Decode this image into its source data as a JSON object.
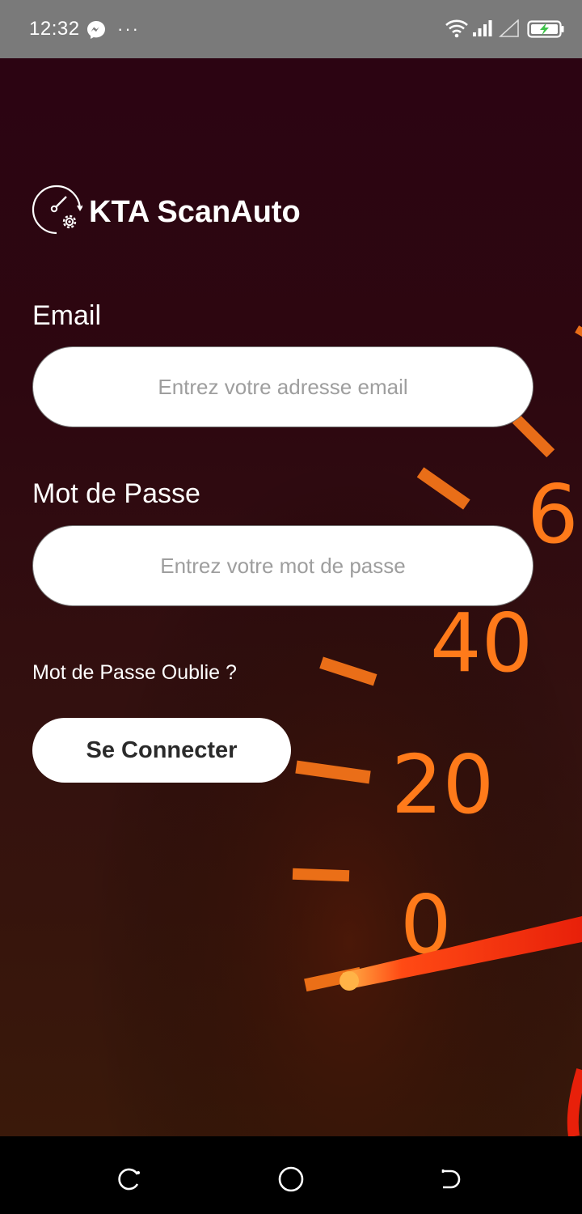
{
  "status_bar": {
    "time": "12:32",
    "icons": [
      "messenger-icon",
      "more-dots-icon",
      "wifi-icon",
      "signal-icon",
      "signal-empty-icon",
      "battery-charging-icon"
    ],
    "dots": "···"
  },
  "app": {
    "title": "KTA ScanAuto",
    "logo_icon": "speedometer-gear-icon"
  },
  "form": {
    "email_label": "Email",
    "email_placeholder": "Entrez votre adresse email",
    "email_value": "",
    "password_label": "Mot de Passe",
    "password_placeholder": "Entrez votre mot de passe",
    "password_value": "",
    "forgot_link": "Mot de Passe Oublie ?",
    "submit_label": "Se Connecter"
  },
  "background": {
    "speedometer_labels": [
      "0",
      "20",
      "40",
      "6"
    ],
    "accent_color": "#ff7a1a",
    "needle_color": "#ff3a12"
  },
  "nav_bar": {
    "icons": [
      "recent-apps-icon",
      "home-icon",
      "back-icon"
    ]
  }
}
